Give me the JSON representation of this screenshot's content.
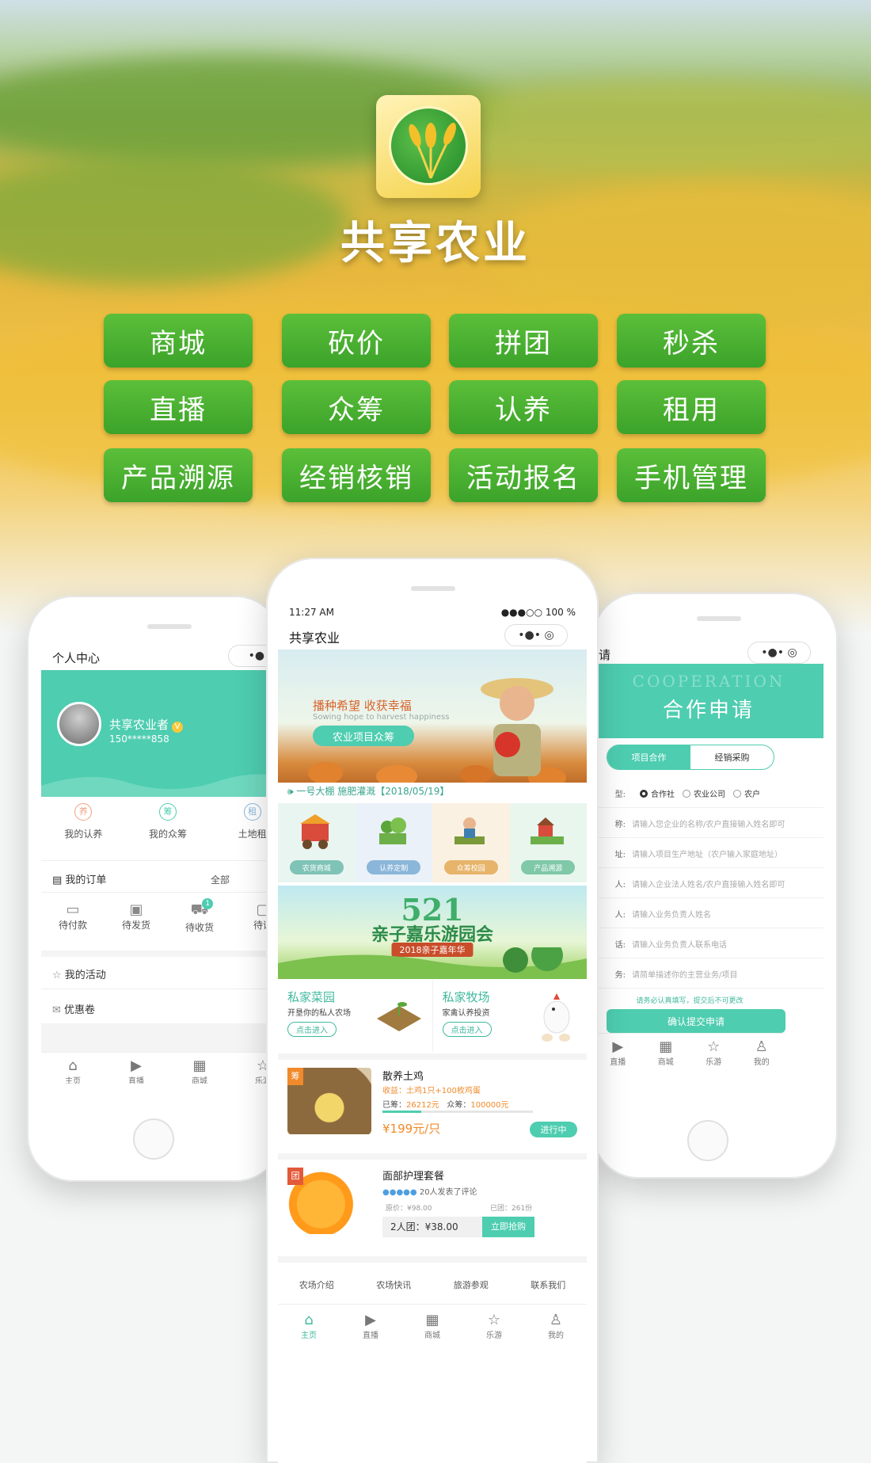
{
  "brand": {
    "title": "共享农业"
  },
  "features": [
    "商城",
    "砍价",
    "拼团",
    "秒杀",
    "直播",
    "众筹",
    "认养",
    "租用",
    "产品溯源",
    "经销核销",
    "活动报名",
    "手机管理"
  ],
  "left_phone": {
    "title": "个人中心",
    "user_name": "共享农业者",
    "user_phone": "150*****858",
    "quick": [
      "我的认养",
      "我的众筹",
      "土地租"
    ],
    "quick_icons": [
      "养",
      "筹",
      "租"
    ],
    "orders_label": "我的订单",
    "orders_all": "全部",
    "order_states": [
      "待付款",
      "待发货",
      "待收货",
      "待评"
    ],
    "order_badge": "1",
    "activity_label": "我的活动",
    "coupon_label": "优惠卷",
    "tabs": [
      "主页",
      "直播",
      "商城",
      "乐游"
    ]
  },
  "center_phone": {
    "time": "11:27 AM",
    "status_right": "●●●○○ 100 %",
    "title": "共享农业",
    "banner_title": "播种希望 收获幸福",
    "banner_sub": "Sowing hope to harvest happiness",
    "banner_button": "农业项目众筹",
    "notice": "一号大棚 施肥灌溉【2018/05/19】",
    "categories": [
      {
        "label": "农货商城",
        "color": "#7fc3b6"
      },
      {
        "label": "认养定制",
        "color": "#8ab6d9"
      },
      {
        "label": "众筹校园",
        "color": "#e6b46a"
      },
      {
        "label": "产品溯源",
        "color": "#7fc8a8"
      }
    ],
    "festival_num": "521",
    "festival_title": "亲子嘉乐游园会",
    "festival_sub": "2018亲子嘉年华",
    "garden": {
      "title": "私家菜园",
      "desc": "开垦你的私人农场",
      "btn": "点击进入"
    },
    "ranch": {
      "title": "私家牧场",
      "desc": "家禽认养投资",
      "btn": "点击进入"
    },
    "item1": {
      "tag": "筹",
      "title": "散养土鸡",
      "gain": "收益：土鸡1只+100枚鸡蛋",
      "raised_label": "已筹：",
      "raised": "26212元",
      "goal_label": "众筹：",
      "goal": "100000元",
      "progress": 0.26,
      "price": "¥199元/只",
      "status": "进行中"
    },
    "item2": {
      "tag": "团",
      "title": "面部护理套餐",
      "reviews": "20人发表了评论",
      "orig": "原价：¥98.00",
      "sold": "已团：261份",
      "group_price": "2人团：¥38.00",
      "buy": "立即抢购"
    },
    "footer_links": [
      "农场介绍",
      "农场快讯",
      "旅游参观",
      "联系我们"
    ],
    "tabs": [
      "主页",
      "直播",
      "商城",
      "乐游",
      "我的"
    ]
  },
  "right_phone": {
    "title": "请",
    "band_en": "COOPERATION",
    "band_cn": "合作申请",
    "seg": [
      "项目合作",
      "经销采购"
    ],
    "type_label": "型:",
    "types": [
      "合作社",
      "农业公司",
      "农户"
    ],
    "rows": [
      {
        "label": "称:",
        "ph": "请输入您企业的名称/农户直接输入姓名即可"
      },
      {
        "label": "址:",
        "ph": "请输入项目生产地址（农户输入家庭地址）"
      },
      {
        "label": "人:",
        "ph": "请输入企业法人姓名/农户直接输入姓名即可"
      },
      {
        "label": "人:",
        "ph": "请输入业务负责人姓名"
      },
      {
        "label": "话:",
        "ph": "请输入业务负责人联系电话"
      },
      {
        "label": "务:",
        "ph": "请简单描述你的主营业务/项目"
      }
    ],
    "note": "请务必认真填写，提交后不可更改",
    "submit": "确认提交申请",
    "tabs": [
      "直播",
      "商城",
      "乐游",
      "我的"
    ]
  }
}
